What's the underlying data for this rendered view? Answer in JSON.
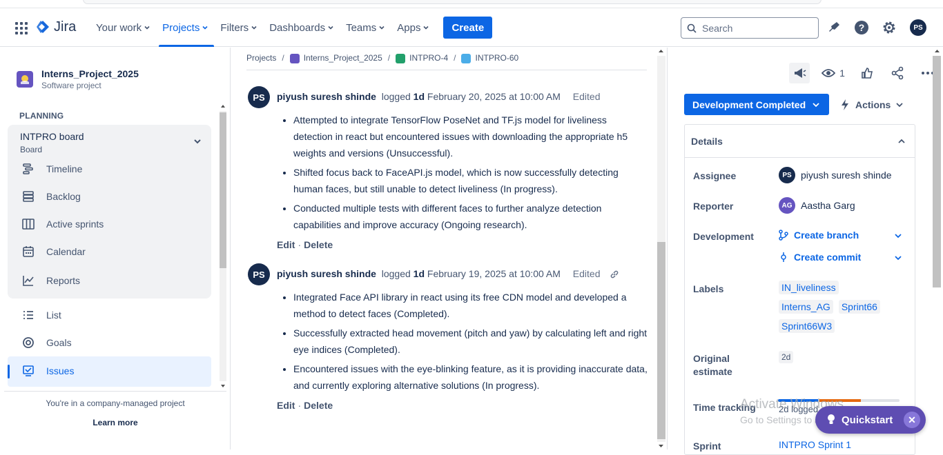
{
  "header": {
    "logo_text": "Jira",
    "nav": [
      "Your work",
      "Projects",
      "Filters",
      "Dashboards",
      "Teams",
      "Apps"
    ],
    "create_label": "Create",
    "search_placeholder": "Search",
    "user_initials": "PS"
  },
  "sidebar": {
    "project_name": "Interns_Project_2025",
    "project_type": "Software project",
    "planning_label": "PLANNING",
    "board_title": "INTPRO board",
    "board_sub": "Board",
    "items": [
      "Timeline",
      "Backlog",
      "Active sprints",
      "Calendar",
      "Reports"
    ],
    "items2": [
      "List",
      "Goals",
      "Issues"
    ],
    "note": "You're in a company-managed project",
    "learn_more": "Learn more"
  },
  "breadcrumbs": [
    "Projects",
    "Interns_Project_2025",
    "INTPRO-4",
    "INTPRO-60"
  ],
  "worklogs": [
    {
      "initials": "PS",
      "author": "piyush suresh shinde",
      "logged_word": "logged",
      "duration": "1d",
      "date": "February 20, 2025 at 10:00 AM",
      "edited": "Edited",
      "bullets": [
        "Attempted to integrate TensorFlow PoseNet and TF.js model for liveliness detection in react but encountered issues with downloading the appropriate h5 weights and versions (Unsuccessful).",
        "Shifted focus back to FaceAPI.js model, which is now successfully detecting human faces, but still unable to detect liveliness (In progress).",
        "Conducted multiple tests with different faces to further analyze detection capabilities and improve accuracy (Ongoing research)."
      ],
      "edit": "Edit",
      "delete": "Delete"
    },
    {
      "initials": "PS",
      "author": "piyush suresh shinde",
      "logged_word": "logged",
      "duration": "1d",
      "date": "February 19, 2025 at 10:00 AM",
      "edited": "Edited",
      "bullets": [
        "Integrated Face API library in react using its free CDN model and developed a method to detect faces (Completed).",
        "Successfully extracted head movement (pitch and yaw) by calculating left and right eye indices (Completed).",
        "Encountered issues with the eye-blinking feature, as it is providing inaccurate data, and currently exploring alternative solutions (In progress)."
      ],
      "edit": "Edit",
      "delete": "Delete"
    }
  ],
  "right": {
    "watch_count": "1",
    "status": "Development Completed",
    "actions": "Actions",
    "details_title": "Details",
    "assignee_label": "Assignee",
    "assignee_initials": "PS",
    "assignee": "piyush suresh shinde",
    "reporter_label": "Reporter",
    "reporter_initials": "AG",
    "reporter": "Aastha Garg",
    "development_label": "Development",
    "create_branch": "Create branch",
    "create_commit": "Create commit",
    "labels_label": "Labels",
    "labels": [
      "IN_liveliness",
      "Interns_AG",
      "Sprint66",
      "Sprint66W3"
    ],
    "original_estimate_label": "Original estimate",
    "original_estimate": "2d",
    "time_tracking_label": "Time tracking",
    "time_logged": "2d logged",
    "sprint_label": "Sprint",
    "sprint": "INTPRO Sprint 1"
  },
  "overlay": {
    "watermark_line1": "Activate Windows",
    "watermark_line2": "Go to Settings to activate Windows.",
    "quickstart": "Quickstart"
  }
}
